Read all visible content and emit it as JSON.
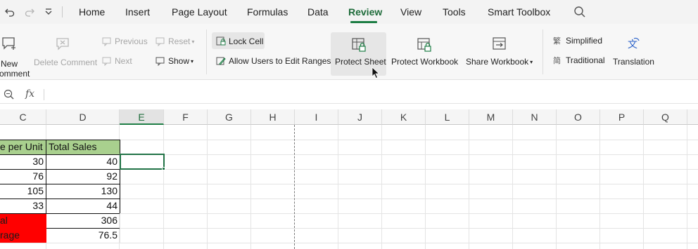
{
  "menu": {
    "tabs": [
      "Home",
      "Insert",
      "Page Layout",
      "Formulas",
      "Data",
      "Review",
      "View",
      "Tools",
      "Smart Toolbox"
    ],
    "active_tab": "Review",
    "quick_access": [
      "undo-icon",
      "redo-icon",
      "customize-quick-access-icon"
    ]
  },
  "ribbon": {
    "new_comment": [
      "New",
      "omment"
    ],
    "delete_comment": "Delete Comment",
    "previous": "Previous",
    "next": "Next",
    "reset": "Reset",
    "show": "Show",
    "lock_cell": "Lock Cell",
    "allow_users": "Allow Users to Edit Ranges",
    "protect_sheet": "Protect Sheet",
    "protect_workbook": "Protect Workbook",
    "share_workbook": "Share Workbook",
    "simplified": "Simplified",
    "traditional": "Traditional",
    "translation": "Translation"
  },
  "formula_bar": {
    "fx": "fx",
    "content": ""
  },
  "grid": {
    "columns": [
      "C",
      "D",
      "E",
      "F",
      "G",
      "H",
      "I",
      "J",
      "K",
      "L",
      "M",
      "N",
      "O",
      "P",
      "Q"
    ],
    "selected_column": "E",
    "headers": {
      "C": "e per Unit",
      "D": "Total Sales"
    },
    "rows": [
      {
        "C": "30",
        "D": "40"
      },
      {
        "C": "76",
        "D": "92"
      },
      {
        "C": "105",
        "D": "130"
      },
      {
        "C": "33",
        "D": "44"
      }
    ],
    "summary": [
      {
        "label": "al",
        "value": "306"
      },
      {
        "label": "rage",
        "value": "76.5"
      }
    ]
  },
  "colors": {
    "accent": "#1e7e45",
    "header_fill": "#a9d08e",
    "summary_fill": "#ff0000"
  }
}
